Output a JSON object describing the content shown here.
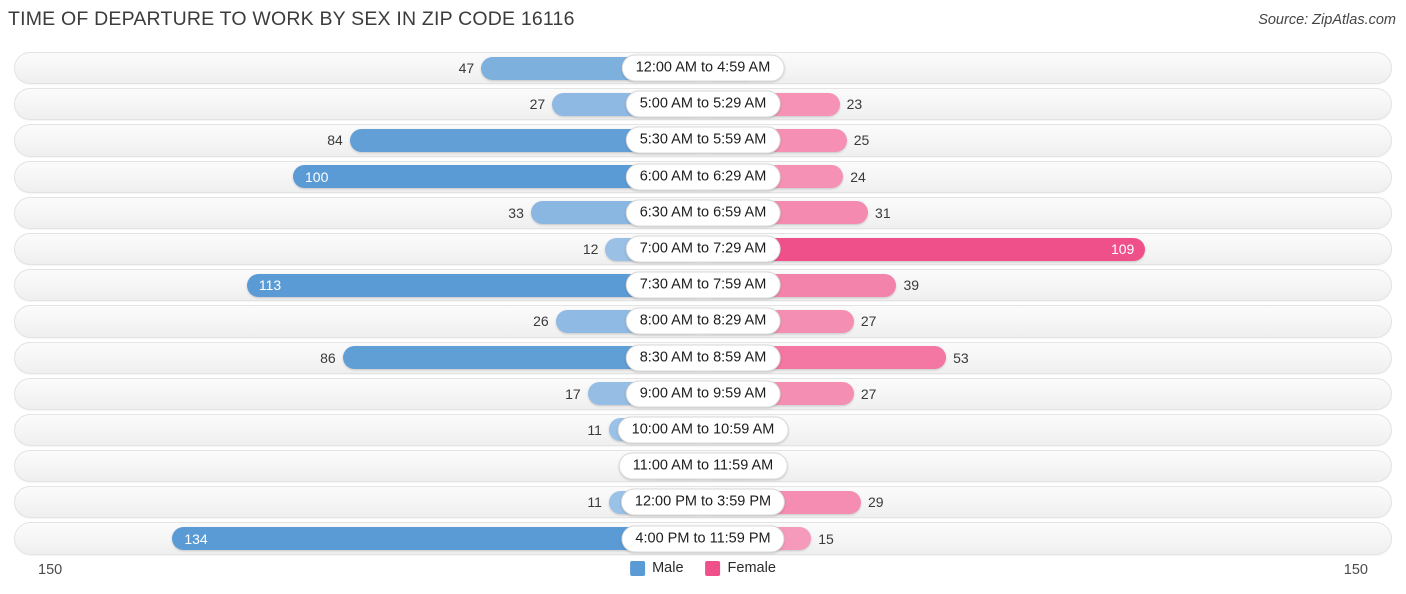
{
  "header": {
    "title": "TIME OF DEPARTURE TO WORK BY SEX IN ZIP CODE 16116",
    "source": "Source: ZipAtlas.com"
  },
  "footer": {
    "axis_left": "150",
    "axis_right": "150",
    "legend": [
      {
        "label": "Male",
        "color": "#5b9bd5"
      },
      {
        "label": "Female",
        "color": "#f0508a"
      }
    ]
  },
  "colors": {
    "male_strong": "#5b9bd5",
    "male_light": "#a3c6e8",
    "female_strong": "#f0508a",
    "female_light": "#f7a8c4",
    "track_bg": "#f6f6f6",
    "track_border": "#e3e3e3"
  },
  "chart_data": {
    "type": "bar",
    "orientation": "horizontal",
    "layout": "diverging-bidirectional",
    "title": "TIME OF DEPARTURE TO WORK BY SEX IN ZIP CODE 16116",
    "xlabel": "",
    "ylabel": "",
    "axis_max": 150,
    "xlim": [
      150,
      150
    ],
    "grid": false,
    "legend_position": "bottom-center",
    "categories": [
      "12:00 AM to 4:59 AM",
      "5:00 AM to 5:29 AM",
      "5:30 AM to 5:59 AM",
      "6:00 AM to 6:29 AM",
      "6:30 AM to 6:59 AM",
      "7:00 AM to 7:29 AM",
      "7:30 AM to 7:59 AM",
      "8:00 AM to 8:29 AM",
      "8:30 AM to 8:59 AM",
      "9:00 AM to 9:59 AM",
      "10:00 AM to 10:59 AM",
      "11:00 AM to 11:59 AM",
      "12:00 PM to 3:59 PM",
      "4:00 PM to 11:59 PM"
    ],
    "series": [
      {
        "name": "Male",
        "side": "left",
        "color": "#5b9bd5",
        "values": [
          47,
          27,
          84,
          100,
          33,
          12,
          113,
          26,
          86,
          17,
          11,
          0,
          11,
          134
        ]
      },
      {
        "name": "Female",
        "side": "right",
        "color": "#f0508a",
        "values": [
          0,
          23,
          25,
          24,
          31,
          109,
          39,
          27,
          53,
          27,
          3,
          0,
          29,
          15
        ]
      }
    ]
  }
}
